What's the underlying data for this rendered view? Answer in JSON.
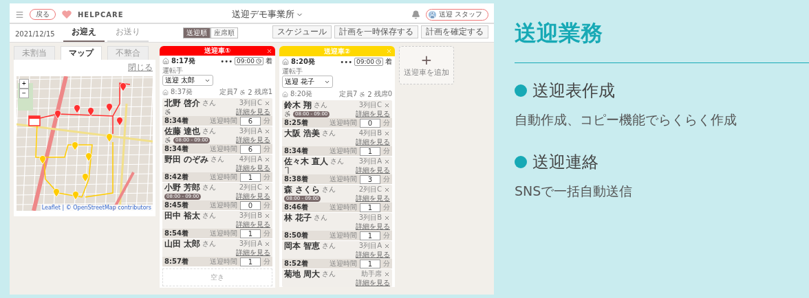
{
  "app": {
    "back_button": "戻る",
    "logo": "HELPCARE",
    "office": "送迎デモ事業所",
    "user": "送迎 スタッフ",
    "date": "2021/12/15",
    "tabs": [
      {
        "label": "お迎え",
        "selected": true
      },
      {
        "label": "お送り",
        "selected": false
      }
    ],
    "order_toggle": [
      {
        "label": "送迎順",
        "selected": true
      },
      {
        "label": "座席順",
        "selected": false
      }
    ],
    "actions": [
      "スケジュール",
      "計画を一時保存する",
      "計画を確定する"
    ],
    "side_tabs": [
      {
        "label": "未割当",
        "selected": false
      },
      {
        "label": "マップ",
        "selected": true
      },
      {
        "label": "不整合",
        "selected": false
      }
    ],
    "close_label": "閉じる",
    "zoom_in": "+",
    "zoom_out": "−",
    "map_attribution": "Leaflet | © OpenStreetMap contributors",
    "cars": [
      {
        "title": "送迎車①",
        "color": "#ff0000",
        "depart": "8:17発",
        "dots": "•••",
        "arrive_time": "09:00",
        "arrive_suffix": "着",
        "driver_label": "運転手",
        "driver": "送迎 太郎",
        "start": "8:37発",
        "capacity": "定員7",
        "wheelchair_count": "2",
        "remaining": "残席1",
        "empty_label": "空き",
        "passengers": [
          {
            "name": "北野 啓介",
            "honorific": "さん",
            "seat": "3列目C",
            "wheelchair": true,
            "cane": false,
            "link": "詳細を見る",
            "arrive": "8:34着",
            "duration_label": "送迎時間",
            "duration": "6",
            "unit": "分"
          },
          {
            "name": "佐藤 達也",
            "honorific": "さん",
            "seat": "3列目A",
            "wheelchair": true,
            "cane": false,
            "window": "08:00 - 09:00",
            "link": "詳細を見る",
            "arrive": "8:34着",
            "duration_label": "送迎時間",
            "duration": "6",
            "unit": "分"
          },
          {
            "name": "野田 のぞみ",
            "honorific": "さん",
            "seat": "4列目A",
            "wheelchair": false,
            "cane": false,
            "link": "詳細を見る",
            "arrive": "8:42着",
            "duration_label": "送迎時間",
            "duration": "1",
            "unit": "分"
          },
          {
            "name": "小野 芳郎",
            "honorific": "さん",
            "seat": "2列目C",
            "wheelchair": false,
            "cane": false,
            "window": "08:00 - 09:00",
            "link": "詳細を見る",
            "arrive": "8:45着",
            "duration_label": "送迎時間",
            "duration": "0",
            "unit": "分"
          },
          {
            "name": "田中 裕太",
            "honorific": "さん",
            "seat": "3列目B",
            "wheelchair": false,
            "cane": false,
            "link": "詳細を見る",
            "arrive": "8:54着",
            "duration_label": "送迎時間",
            "duration": "1",
            "unit": "分"
          },
          {
            "name": "山田 太郎",
            "honorific": "さん",
            "seat": "3列目A",
            "wheelchair": false,
            "cane": false,
            "link": "詳細を見る",
            "arrive": "8:57着",
            "duration_label": "送迎時間",
            "duration": "1",
            "unit": "分"
          }
        ]
      },
      {
        "title": "送迎車②",
        "color": "#ffd800",
        "depart": "8:20発",
        "dots": "•••",
        "arrive_time": "09:00",
        "arrive_suffix": "着",
        "driver_label": "運転手",
        "driver": "送迎 花子",
        "start": "8:20発",
        "capacity": "定員7",
        "wheelchair_count": "2",
        "remaining": "残席0",
        "passengers": [
          {
            "name": "鈴木 翔",
            "honorific": "さん",
            "seat": "3列目C",
            "wheelchair": true,
            "cane": false,
            "window": "08:00 - 09:00",
            "link": "詳細を見る",
            "arrive": "8:25着",
            "duration_label": "送迎時間",
            "duration": "0",
            "unit": "分"
          },
          {
            "name": "大阪 浩美",
            "honorific": "さん",
            "seat": "4列目B",
            "wheelchair": false,
            "cane": false,
            "link": "詳細を見る",
            "arrive": "8:34着",
            "duration_label": "送迎時間",
            "duration": "1",
            "unit": "分"
          },
          {
            "name": "佐々木 直人",
            "honorific": "さん",
            "seat": "3列目A",
            "wheelchair": false,
            "cane": true,
            "link": "詳細を見る",
            "arrive": "8:38着",
            "duration_label": "送迎時間",
            "duration": "3",
            "unit": "分"
          },
          {
            "name": "森 さくら",
            "honorific": "さん",
            "seat": "2列目C",
            "wheelchair": false,
            "cane": false,
            "window": "08:00 - 09:00",
            "link": "詳細を見る",
            "arrive": "8:46着",
            "duration_label": "送迎時間",
            "duration": "1",
            "unit": "分"
          },
          {
            "name": "林 花子",
            "honorific": "さん",
            "seat": "3列目B",
            "wheelchair": false,
            "cane": false,
            "link": "詳細を見る",
            "arrive": "8:50着",
            "duration_label": "送迎時間",
            "duration": "1",
            "unit": "分"
          },
          {
            "name": "岡本 智恵",
            "honorific": "さん",
            "seat": "3列目A",
            "wheelchair": false,
            "cane": false,
            "link": "詳細を見る",
            "arrive": "8:52着",
            "duration_label": "送迎時間",
            "duration": "1",
            "unit": "分"
          },
          {
            "name": "菊地 周大",
            "honorific": "さん",
            "seat": "助手席",
            "wheelchair": false,
            "cane": false,
            "link": "詳細を見る"
          }
        ]
      }
    ],
    "add_car_icon": "+",
    "add_car_label": "送迎車を追加"
  },
  "feature": {
    "title": "送迎業務",
    "items": [
      {
        "heading": "送迎表作成",
        "text": "自動作成、コピー機能でらくらく作成"
      },
      {
        "heading": "送迎連絡",
        "text": "SNSで一括自動送信"
      }
    ]
  }
}
